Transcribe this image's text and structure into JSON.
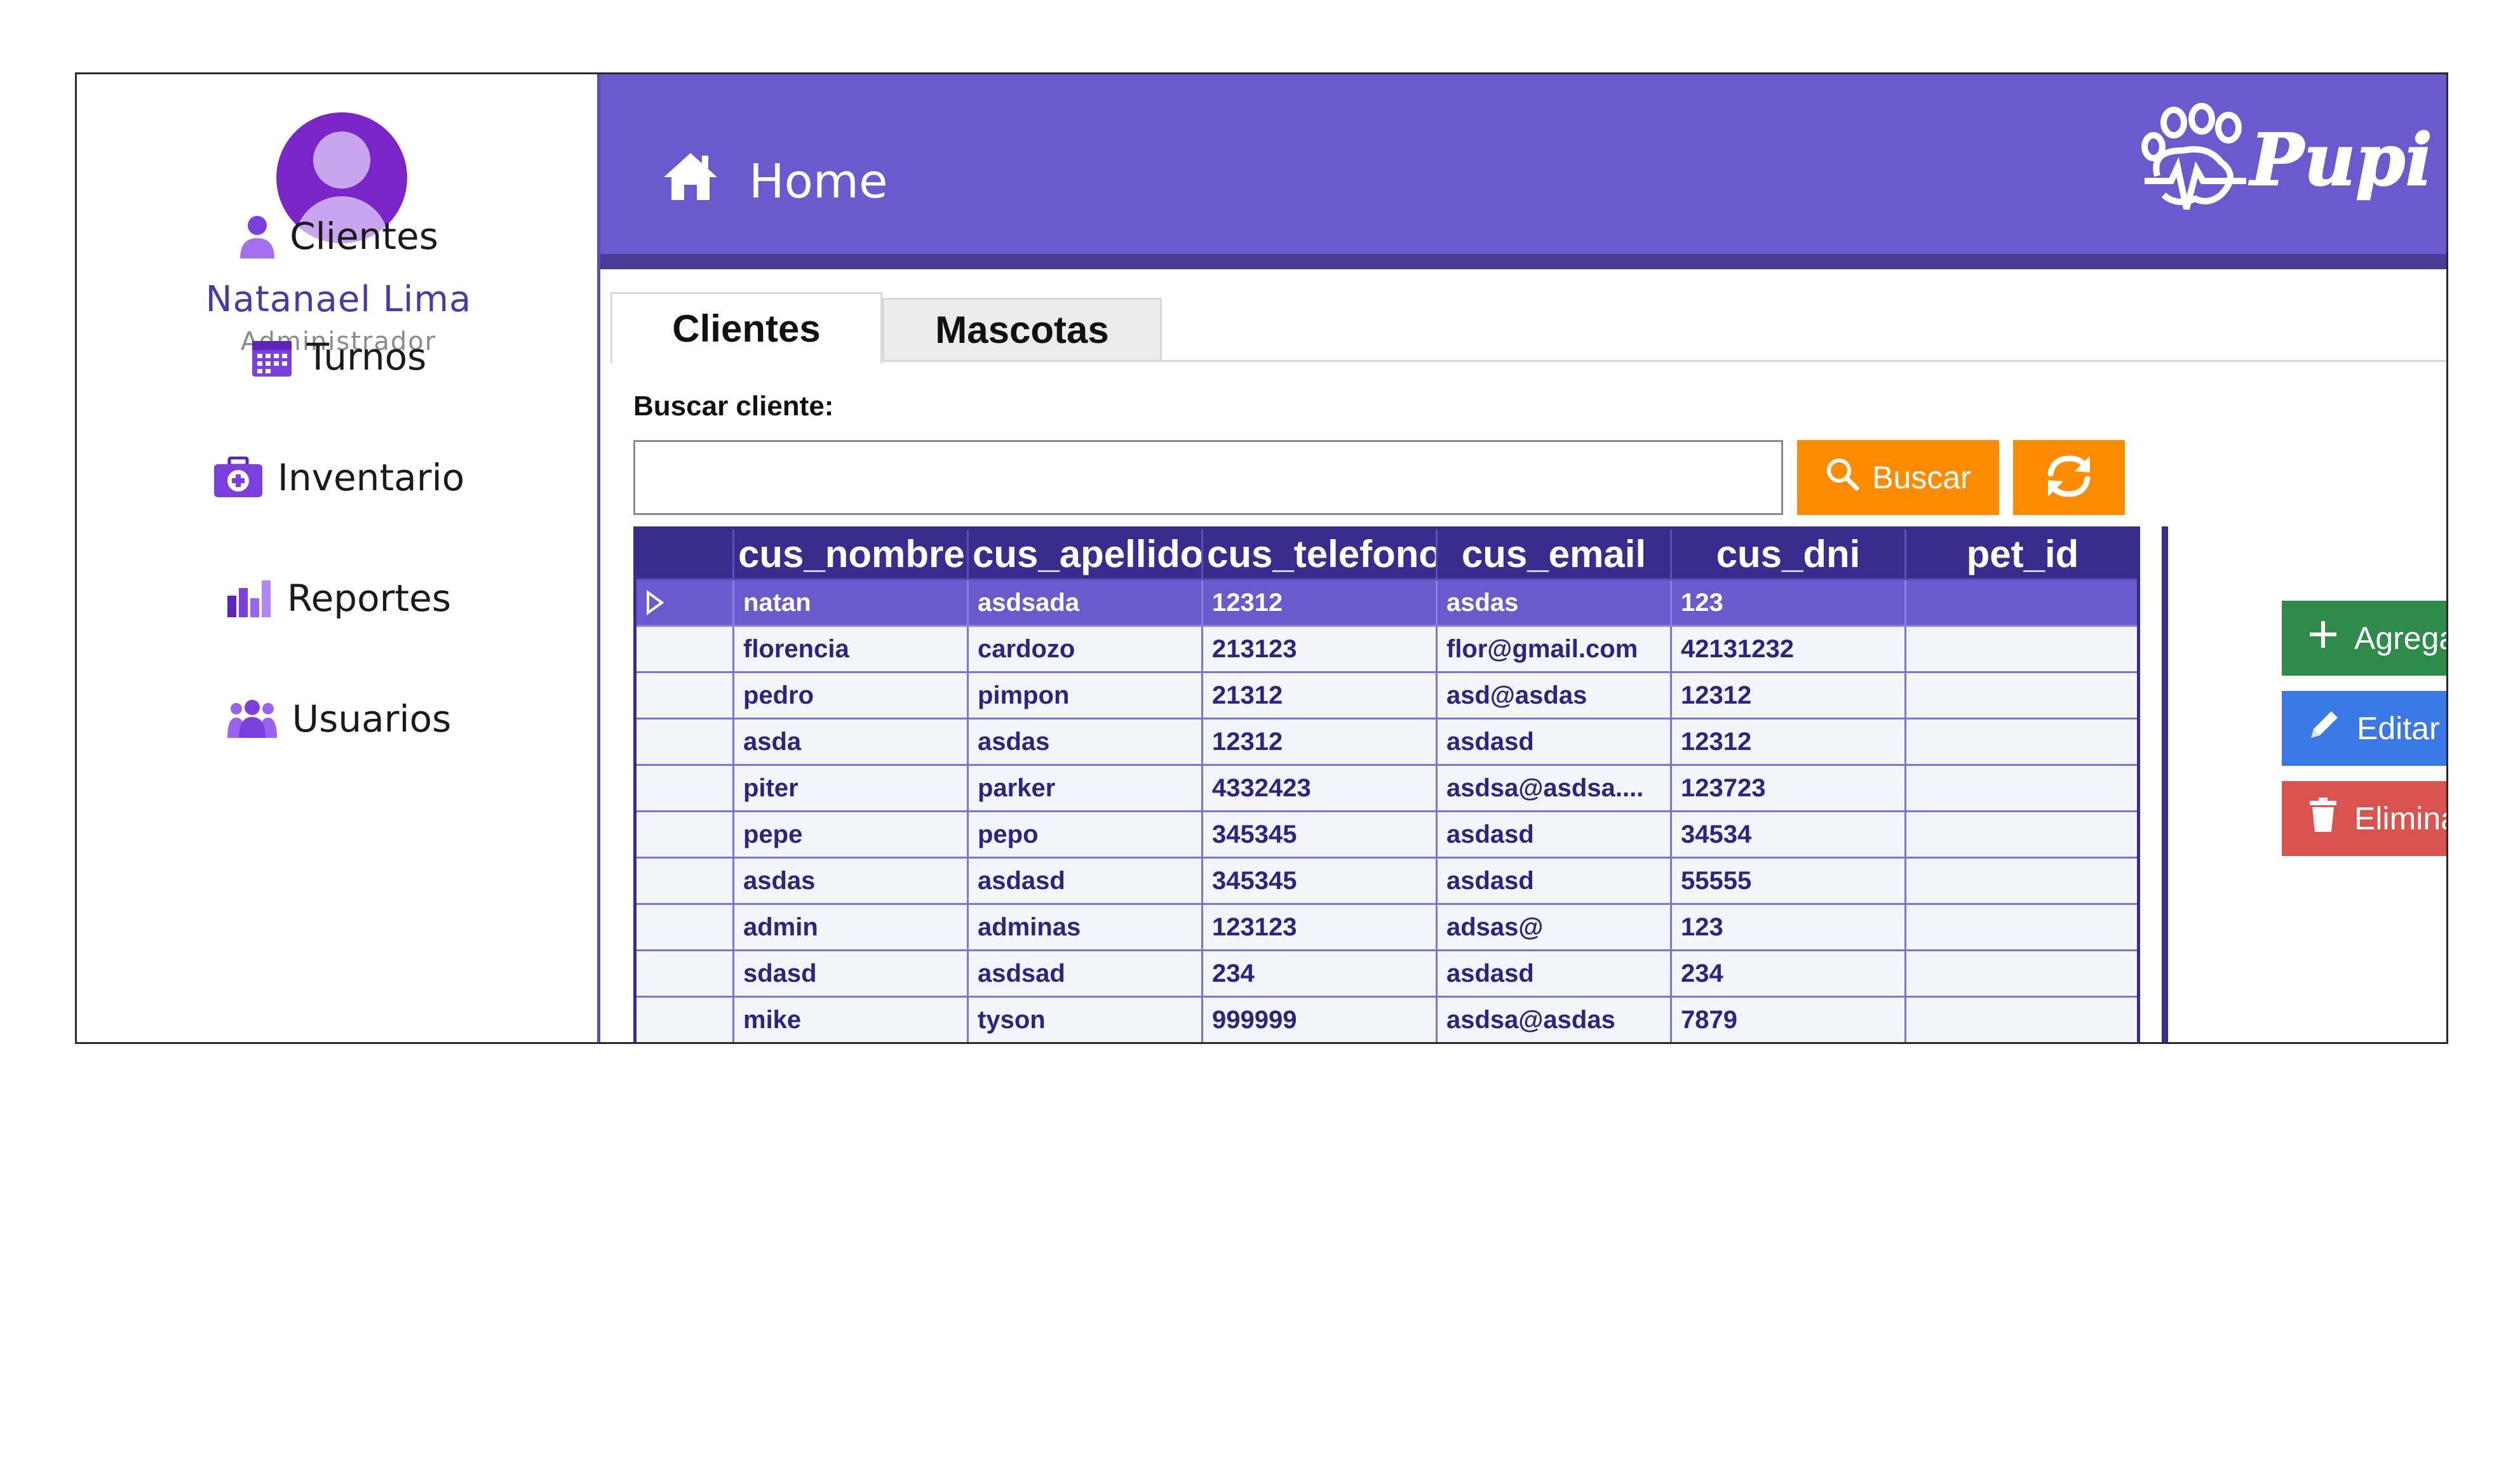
{
  "user": {
    "name": "Natanael Lima",
    "role": "Administrador"
  },
  "sidebar": {
    "items": [
      {
        "label": "Clientes",
        "icon": "user-icon"
      },
      {
        "label": "Turnos",
        "icon": "calendar-icon"
      },
      {
        "label": "Inventario",
        "icon": "medical-kit-icon"
      },
      {
        "label": "Reportes",
        "icon": "bar-chart-icon"
      },
      {
        "label": "Usuarios",
        "icon": "users-icon"
      }
    ]
  },
  "header": {
    "title": "Home",
    "logo": "Pupi"
  },
  "tabs": [
    {
      "label": "Clientes",
      "active": true
    },
    {
      "label": "Mascotas",
      "active": false
    }
  ],
  "search": {
    "label": "Buscar cliente:",
    "value": "",
    "button_label": "Buscar"
  },
  "table": {
    "columns": [
      "cus_nombre",
      "cus_apellido",
      "cus_telefono",
      "cus_email",
      "cus_dni",
      "pet_id"
    ],
    "rows": [
      [
        "natan",
        "asdsada",
        "12312",
        "asdas",
        "123",
        ""
      ],
      [
        "florencia",
        "cardozo",
        "213123",
        "flor@gmail.com",
        "42131232",
        ""
      ],
      [
        "pedro",
        "pimpon",
        "21312",
        "asd@asdas",
        "12312",
        ""
      ],
      [
        "asda",
        "asdas",
        "12312",
        "asdasd",
        "12312",
        ""
      ],
      [
        "piter",
        "parker",
        "4332423",
        "asdsa@asdsa....",
        "123723",
        ""
      ],
      [
        "pepe",
        "pepo",
        "345345",
        "asdasd",
        "34534",
        ""
      ],
      [
        "asdas",
        "asdasd",
        "345345",
        "asdasd",
        "55555",
        ""
      ],
      [
        "admin",
        "adminas",
        "123123",
        "adsas@",
        "123",
        ""
      ],
      [
        "sdasd",
        "asdsad",
        "234",
        "asdasd",
        "234",
        ""
      ],
      [
        "mike",
        "tyson",
        "999999",
        "asdsa@asdas",
        "7879",
        ""
      ]
    ],
    "selected_row": 0
  },
  "actions": {
    "add_label": "Agregar",
    "edit_label": "Editar",
    "delete_label": "Eliminar"
  },
  "colors": {
    "header": "#6a5acd",
    "grid_header": "#3a2c8c",
    "buscar": "#ff8c00",
    "agregar": "#2e8b4a",
    "editar": "#3a78e6",
    "eliminar": "#d9534f"
  }
}
